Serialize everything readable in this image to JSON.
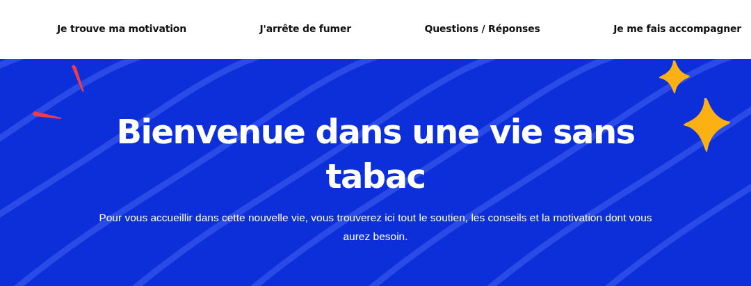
{
  "nav": {
    "items": [
      {
        "label": "Je trouve ma motivation"
      },
      {
        "label": "J'arrête de fumer"
      },
      {
        "label": "Questions / Réponses"
      },
      {
        "label": "Je me fais accompagner"
      }
    ]
  },
  "hero": {
    "title": "Bienvenue dans une vie sans tabac",
    "subtitle": "Pour vous accueillir dans cette nouvelle vie, vous trouverez ici tout le soutien, les conseils et la motivation dont vous aurez besoin."
  }
}
